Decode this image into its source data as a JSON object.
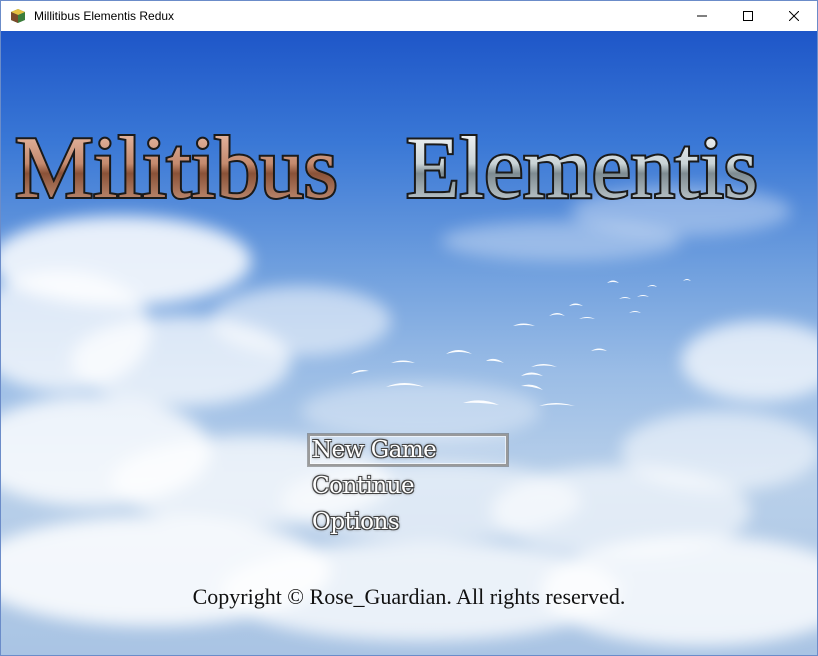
{
  "window": {
    "title": "Millitibus Elementis Redux"
  },
  "game": {
    "logo": "Militibus Elementis",
    "logo_part1": "Militibus",
    "logo_part2": "Elementis",
    "menu": [
      {
        "label": "New Game",
        "selected": true
      },
      {
        "label": "Continue",
        "selected": false
      },
      {
        "label": "Options",
        "selected": false
      }
    ],
    "copyright": "Copyright © Rose_Guardian. All rights reserved."
  },
  "colors": {
    "sky_top": "#1e56c8",
    "sky_bottom": "#a9c4e4",
    "logo_part1": "#c48a6e",
    "logo_part2": "#c9d3d6"
  }
}
